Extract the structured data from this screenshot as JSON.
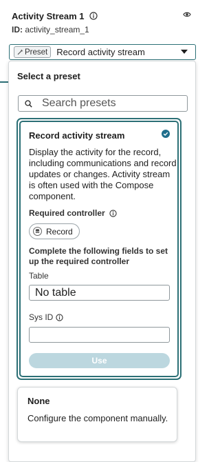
{
  "header": {
    "title": "Activity Stream 1",
    "id_label": "ID:",
    "id_value": "activity_stream_1"
  },
  "preset_select": {
    "badge_label": "Preset",
    "selected_value": "Record activity stream"
  },
  "dropdown": {
    "title": "Select a preset",
    "search": {
      "placeholder": "Search presets",
      "value": ""
    },
    "presets": [
      {
        "title": "Record activity stream",
        "selected": true,
        "description": "Display the activity for the record, including communications and record updates or changes. Activity stream is often used with the Compose component.",
        "required_controller_label": "Required controller",
        "controller_pill": "Record",
        "complete_note": "Complete the following fields to set up the required controller",
        "table_label": "Table",
        "table_value": "No table",
        "sysid_label": "Sys ID",
        "sysid_value": "",
        "use_button": "Use"
      },
      {
        "title": "None",
        "selected": false,
        "description": "Configure the component manually."
      }
    ]
  },
  "colors": {
    "accent": "#2b6f75",
    "use_button_bg": "#bcd7df",
    "check_fill": "#1f6e8c"
  }
}
